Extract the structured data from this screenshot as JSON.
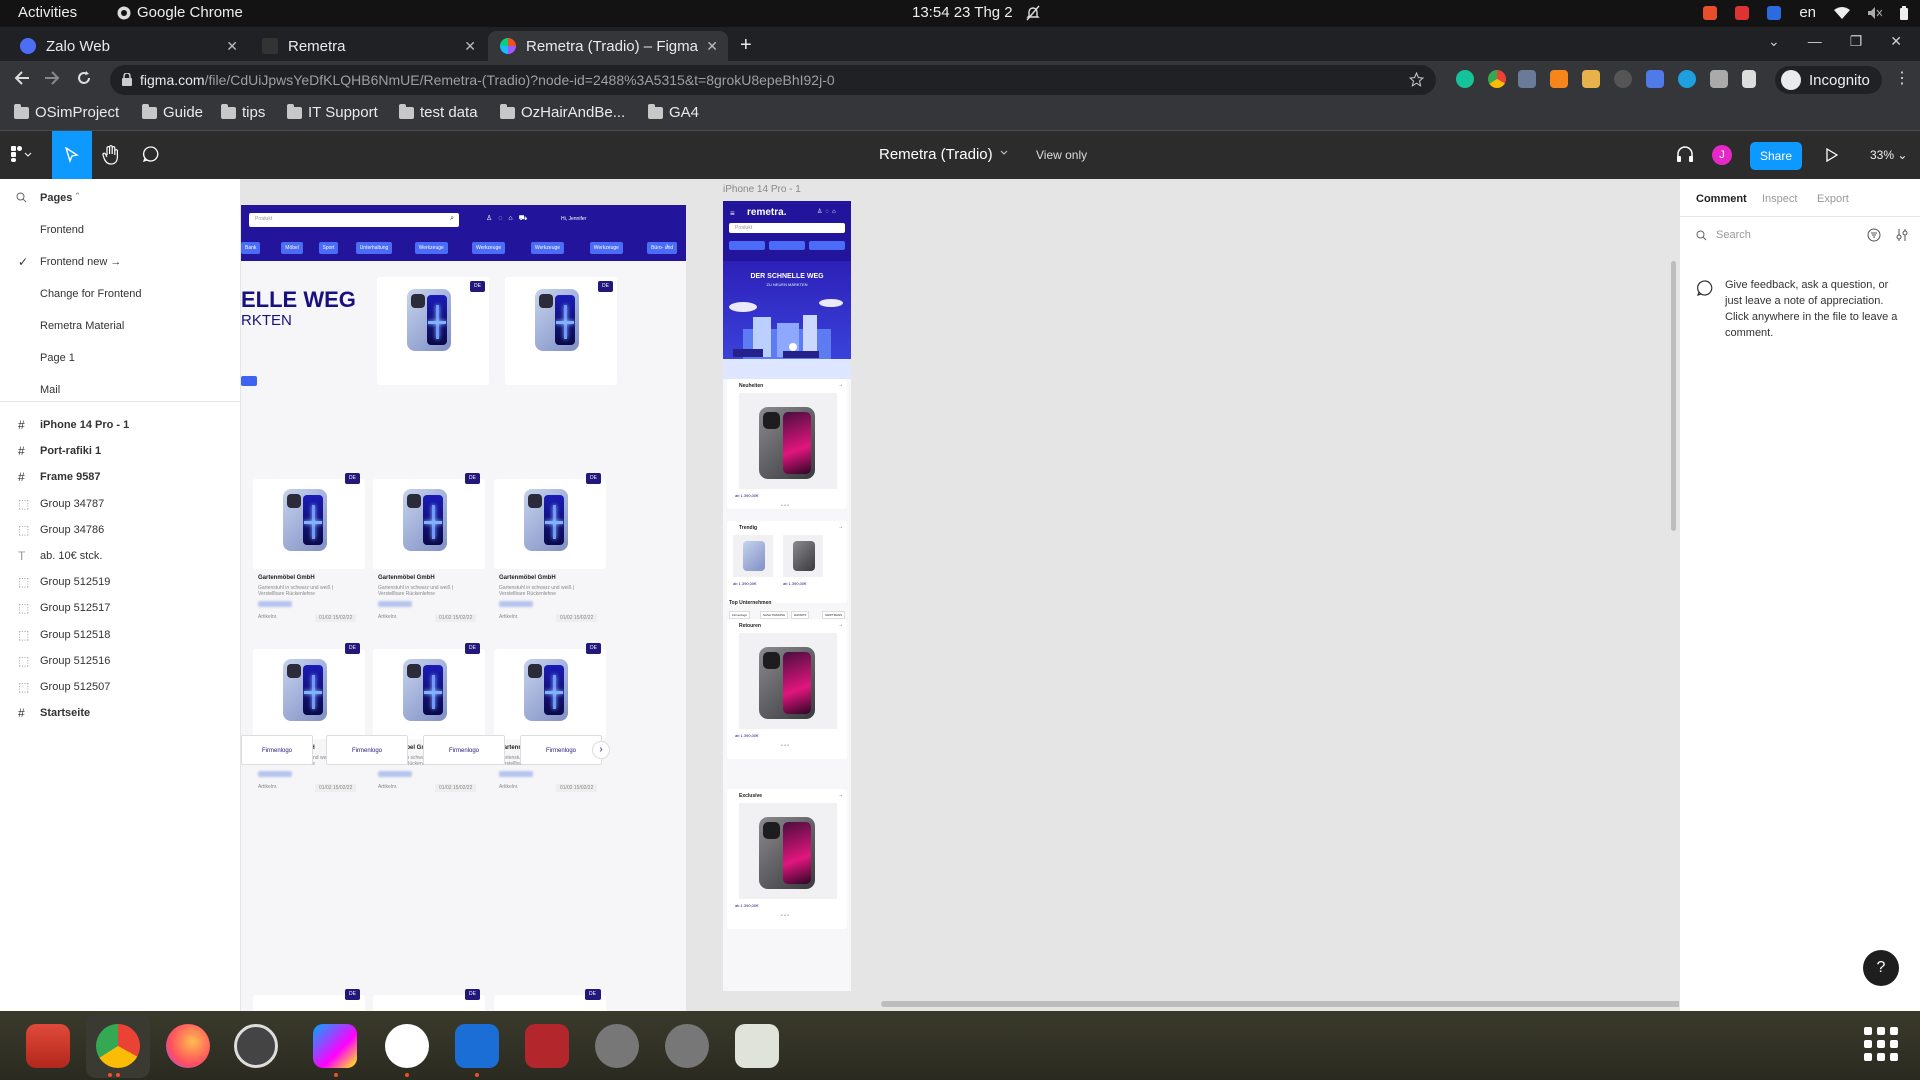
{
  "system_bar": {
    "activities": "Activities",
    "app_name": "Google Chrome",
    "clock": "13:54  23 Thg 2",
    "lang": "en"
  },
  "tabs": [
    {
      "title": "Zalo Web",
      "color": "#4c6ef5"
    },
    {
      "title": "Remetra",
      "color": "#222222"
    },
    {
      "title": "Remetra (Tradio) – Figma",
      "color": "#f24e1e"
    }
  ],
  "omnibox": {
    "host": "figma.com",
    "path": "/file/CdUiJpwsYeDfKLQHB6NmUE/Remetra-(Tradio)?node-id=2488%3A5315&t=8grokU8epeBhI92j-0"
  },
  "incognito_label": "Incognito",
  "bookmarks": [
    "OSimProject",
    "Guide",
    "tips",
    "IT Support",
    "test data",
    "OzHairAndBe...",
    "GA4"
  ],
  "figma": {
    "file_title": "Remetra (Tradio)",
    "view_only": "View only",
    "share_label": "Share",
    "avatar_initial": "J",
    "zoom": "33%"
  },
  "left_panel": {
    "pages_heading": "Pages",
    "pages": [
      "Frontend",
      "Frontend new →",
      "Change for Frontend",
      "Remetra Material",
      "Page 1",
      "Mail"
    ],
    "layers": [
      {
        "name": "iPhone 14 Pro - 1",
        "icon": "frame-icon",
        "bold": true
      },
      {
        "name": "Port-rafiki 1",
        "icon": "frame-icon",
        "bold": true
      },
      {
        "name": "Frame 9587",
        "icon": "frame-icon",
        "bold": true
      },
      {
        "name": "Group 34787",
        "icon": "group-icon",
        "bold": false
      },
      {
        "name": "Group 34786",
        "icon": "group-icon",
        "bold": false
      },
      {
        "name": "ab. 10€ stck.",
        "icon": "text-icon",
        "bold": false
      },
      {
        "name": "Group 512519",
        "icon": "group-icon",
        "bold": false
      },
      {
        "name": "Group 512517",
        "icon": "group-icon",
        "bold": false
      },
      {
        "name": "Group 512518",
        "icon": "group-icon",
        "bold": false
      },
      {
        "name": "Group 512516",
        "icon": "group-icon",
        "bold": false
      },
      {
        "name": "Group 512507",
        "icon": "group-icon",
        "bold": false
      },
      {
        "name": "Startseite",
        "icon": "frame-icon",
        "bold": true
      }
    ]
  },
  "canvas": {
    "frame_label": "iPhone 14 Pro - 1",
    "desktop": {
      "search_placeholder": "Produkt",
      "user_label": "Hi, Jennifer",
      "hero_line1": "ELLE WEG",
      "hero_line2": "RKTEN",
      "categories": [
        "Bank",
        "Möbel",
        "Sport",
        "Unterhaltung",
        "Werkzeuge",
        "Werkzeuge",
        "Werkzeuge",
        "Werkzeuge",
        "Büro- und"
      ],
      "badge": "DE",
      "product_title": "Gartenmöbel GmbH",
      "product_desc": "Gartenstuhl in schwarz und weiß | Verstellbare Rückenlehne",
      "article_label": "Artikelnr.",
      "article_code": "01/02 15/02/22",
      "firm_logo": "Firmenlogo"
    },
    "mobile": {
      "brand": "remetra.",
      "search_placeholder": "Produkt",
      "hero_title": "DER SCHNELLE WEG",
      "hero_sub": "ZU NEUEN MÄRKTEN",
      "sections": [
        "Neuheiten",
        "Trendig",
        "Retouren",
        "Exclusive"
      ],
      "price": "ab 1.390,00€",
      "top_companies": "Top Unternehmen",
      "company_chips": [
        "Firmenlogo",
        "SASA TRADING",
        "DATAPIX",
        "SHIPTRANS"
      ]
    }
  },
  "right_panel": {
    "tabs": [
      "Comment",
      "Inspect",
      "Export"
    ],
    "search_placeholder": "Search",
    "hint": "Give feedback, ask a question, or just leave a note of appreciation. Click anywhere in the file to leave a comment.",
    "help": "?"
  }
}
